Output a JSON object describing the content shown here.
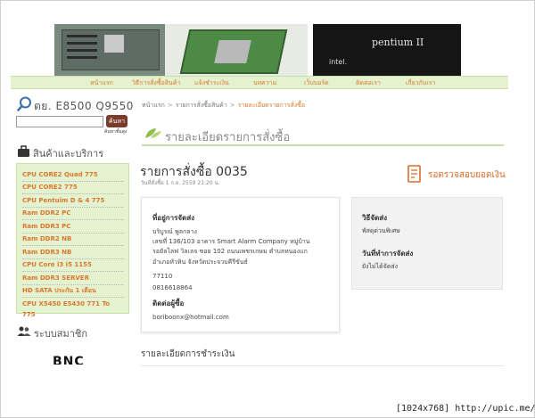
{
  "header": {
    "banner_text_cpu": "pentium II",
    "banner_text_brand": "intel."
  },
  "nav": {
    "items": [
      "หน้าแรก",
      "วิธีการสั่งซื้อสินค้า",
      "แจ้งชำระเงิน",
      "บทความ",
      "เว็บบอร์ด",
      "ติดต่อเรา",
      "เกี่ยวกับเรา"
    ]
  },
  "sidebar": {
    "search_title": "ตย. E8500 Q9550",
    "search_value": "",
    "search_button": "ค้นหา",
    "search_advanced": "ค้นหาขั้นสูง",
    "categories_title": "สินค้าและบริการ",
    "categories": [
      "CPU CORE2 Quad 775",
      "CPU CORE2 775",
      "CPU Pentuim D & 4 775",
      "Ram DDR2 PC",
      "Ram DDR3 PC",
      "Ram DDR2 NB",
      "Ram DDR3 NB",
      "CPU Core i3 i5 1155",
      "Ram DDR3 SERVER",
      "HD SATA ประกัน 1 เดือน",
      "CPU X5450 E5430 771 To 775"
    ],
    "member_title": "ระบบสมาชิก",
    "logo_text": "BNC"
  },
  "breadcrumb": {
    "items": [
      "หน้าแรก",
      "รายการสั่งซื้อสินค้า",
      "รายละเอียดรายการสั่งซื้อ"
    ]
  },
  "page": {
    "title": "รายละเอียดรายการสั่งซื้อ",
    "order_number": "รายการสั่งซื้อ 0035",
    "order_date": "วันที่สั่งซื้อ 1 ก.ย. 2559 21:20 น.",
    "check_payment": "รอตรวจสอบยอดเงิน"
  },
  "address": {
    "label": "ที่อยู่การจัดส่ง",
    "lines": [
      "บริบูรณ์ พูลกลาง",
      "เลขที่ 136/103 อาคาร Smart Alarm Company หมู่บ้าน",
      "รอยัลไลฟ วิลเลจ ซอย 102 ถนนเพชรเกษม ตำบลหนองแก",
      "อำเภอหัวหิน จังหวัดประจวบคีรีขันธ์",
      "77110",
      "0816618864"
    ],
    "contact_label": "ติดต่อผู้ซื้อ",
    "email": "boriboonx@hotmail.com"
  },
  "shipping": {
    "method_label": "วิธีจัดส่ง",
    "method_value": "พัสดุด่วนพิเศษ",
    "date_label": "วันที่ทำการจัดส่ง",
    "date_value": "ยังไม่ได้จัดส่ง"
  },
  "payment": {
    "title": "รายละเอียดการชำระเงิน"
  },
  "watermark": "[1024x768] http://upic.me/",
  "colors": {
    "accent": "#d9782d",
    "nav_bg": "#e5f2cf",
    "button": "#7a3b2b"
  }
}
